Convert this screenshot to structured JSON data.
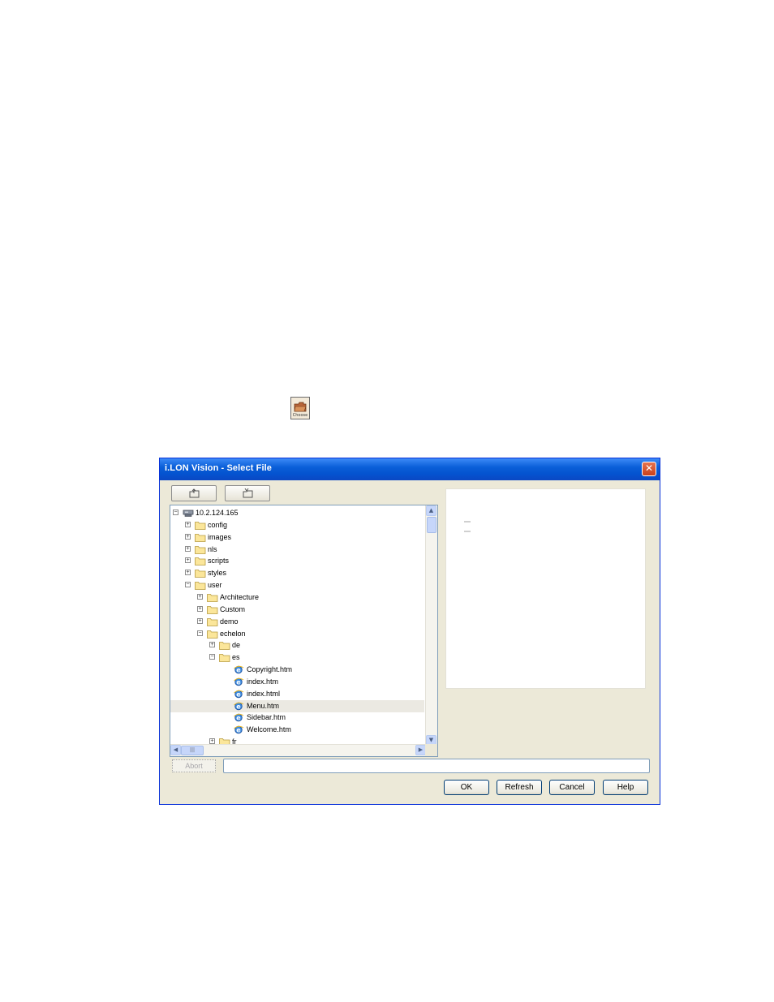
{
  "choose_icon": {
    "caption": "Choose"
  },
  "dialog": {
    "title": "i.LON Vision - Select File",
    "close_glyph": "✕",
    "toolbar": [
      {
        "name": "go-up-folder-button",
        "icon": "folder-up-icon"
      },
      {
        "name": "new-folder-button",
        "icon": "new-folder-icon"
      }
    ],
    "tree": {
      "selected_index": 16,
      "rows": [
        {
          "label": "10.2.124.165",
          "level": 0,
          "type": "server",
          "expander": "minus"
        },
        {
          "label": "config",
          "level": 1,
          "type": "folder",
          "expander": "plus"
        },
        {
          "label": "images",
          "level": 1,
          "type": "folder",
          "expander": "plus"
        },
        {
          "label": "nls",
          "level": 1,
          "type": "folder",
          "expander": "plus"
        },
        {
          "label": "scripts",
          "level": 1,
          "type": "folder",
          "expander": "plus"
        },
        {
          "label": "styles",
          "level": 1,
          "type": "folder",
          "expander": "plus"
        },
        {
          "label": "user",
          "level": 1,
          "type": "folder",
          "expander": "minus"
        },
        {
          "label": "Architecture",
          "level": 2,
          "type": "folder",
          "expander": "plus"
        },
        {
          "label": "Custom",
          "level": 2,
          "type": "folder",
          "expander": "plus"
        },
        {
          "label": "demo",
          "level": 2,
          "type": "folder",
          "expander": "plus"
        },
        {
          "label": "echelon",
          "level": 2,
          "type": "folder",
          "expander": "minus"
        },
        {
          "label": "de",
          "level": 3,
          "type": "folder",
          "expander": "plus"
        },
        {
          "label": "es",
          "level": 3,
          "type": "folder",
          "expander": "minus"
        },
        {
          "label": "Copyright.htm",
          "level": 4,
          "type": "file",
          "expander": ""
        },
        {
          "label": "index.htm",
          "level": 4,
          "type": "file",
          "expander": ""
        },
        {
          "label": "index.html",
          "level": 4,
          "type": "file",
          "expander": ""
        },
        {
          "label": "Menu.htm",
          "level": 4,
          "type": "file",
          "expander": ""
        },
        {
          "label": "Sidebar.htm",
          "level": 4,
          "type": "file",
          "expander": ""
        },
        {
          "label": "Welcome.htm",
          "level": 4,
          "type": "file",
          "expander": ""
        },
        {
          "label": "fr",
          "level": 3,
          "type": "folder",
          "expander": "plus"
        }
      ]
    },
    "abort_label": "Abort",
    "status_value": "",
    "buttons": {
      "ok": "OK",
      "refresh": "Refresh",
      "cancel": "Cancel",
      "help": "Help"
    },
    "colors": {
      "titlebar": "#0453d0",
      "face": "#ece9d8",
      "border": "#7f9db9"
    }
  }
}
